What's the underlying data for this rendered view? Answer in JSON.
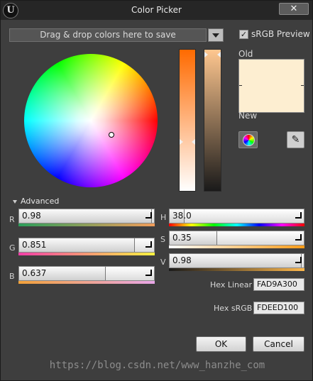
{
  "window": {
    "title": "Color Picker",
    "close_glyph": "✕",
    "logo_letter": "U"
  },
  "save_area": {
    "placeholder": "Drag & drop colors here to save"
  },
  "srgb_preview": {
    "label": "sRGB Preview",
    "checked": true,
    "check_glyph": "✓"
  },
  "color_wheel": {
    "selection": {
      "hue_deg": 38.0,
      "saturation": 0.35,
      "value": 0.98
    }
  },
  "swatches": {
    "old_label": "Old",
    "new_label": "New",
    "new_color": "#FDEED1"
  },
  "tools": {
    "color_wheel_icon": "color-wheel-icon",
    "eyedropper_icon": "eyedropper-icon",
    "eyedropper_glyph": "✎"
  },
  "advanced": {
    "label": "Advanced",
    "rgb": [
      {
        "label": "R",
        "value": "0.98",
        "fraction": 0.98
      },
      {
        "label": "G",
        "value": "0.851",
        "fraction": 0.851
      },
      {
        "label": "B",
        "value": "0.637",
        "fraction": 0.637
      }
    ],
    "hsv": [
      {
        "label": "H",
        "value": "38.0",
        "fraction": 0.106
      },
      {
        "label": "S",
        "value": "0.35",
        "fraction": 0.35
      },
      {
        "label": "V",
        "value": "0.98",
        "fraction": 0.98
      }
    ],
    "hex_linear": {
      "label": "Hex Linear",
      "value": "FAD9A300"
    },
    "hex_srgb": {
      "label": "Hex sRGB",
      "value": "FDEED100"
    }
  },
  "buttons": {
    "ok": "OK",
    "cancel": "Cancel"
  },
  "watermark": "https://blog.csdn.net/www_hanzhe_com"
}
